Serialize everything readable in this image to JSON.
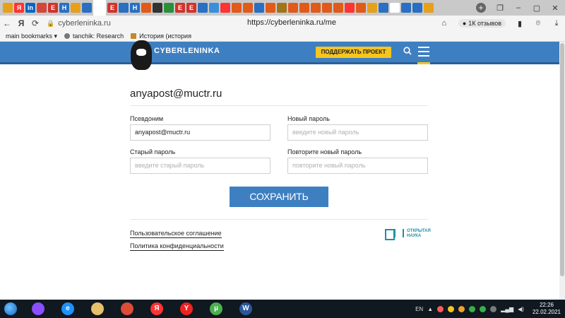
{
  "browser": {
    "tab_favicons": [
      {
        "icon": "mail-icon",
        "color": "#e6a01a",
        "text": ""
      },
      {
        "icon": "yandex-icon",
        "color": "#ff3333",
        "text": "Я"
      },
      {
        "icon": "linkedin-icon",
        "color": "#0a66c2",
        "text": "in"
      },
      {
        "icon": "gmail-icon",
        "color": "#d44638",
        "text": ""
      },
      {
        "icon": "e-icon",
        "color": "#d0342c",
        "text": "E"
      },
      {
        "icon": "h-icon",
        "color": "#2a6fc1",
        "text": "H"
      },
      {
        "icon": "mail-icon",
        "color": "#e6a01a",
        "text": ""
      },
      {
        "icon": "doc-icon",
        "color": "#2a6fc1",
        "text": ""
      },
      {
        "icon": "cyberleninka-icon",
        "color": "#ffffff",
        "text": ""
      },
      {
        "icon": "e-icon",
        "color": "#d0342c",
        "text": "E"
      },
      {
        "icon": "doc-icon",
        "color": "#2a6fc1",
        "text": ""
      },
      {
        "icon": "h-icon",
        "color": "#2a6fc1",
        "text": "H"
      },
      {
        "icon": "grid-icon",
        "color": "#e05a1a",
        "text": ""
      },
      {
        "icon": "circle-icon",
        "color": "#333333",
        "text": ""
      },
      {
        "icon": "arrow-icon",
        "color": "#2a8f3a",
        "text": ""
      },
      {
        "icon": "e-icon",
        "color": "#d0342c",
        "text": "E"
      },
      {
        "icon": "e-icon",
        "color": "#d0342c",
        "text": "E"
      },
      {
        "icon": "planet-icon",
        "color": "#2a6fc1",
        "text": ""
      },
      {
        "icon": "bird-icon",
        "color": "#3a8fd9",
        "text": ""
      },
      {
        "icon": "yandex-icon",
        "color": "#ff3333",
        "text": ""
      },
      {
        "icon": "grid-icon",
        "color": "#e05a1a",
        "text": ""
      },
      {
        "icon": "grid-icon",
        "color": "#e05a1a",
        "text": ""
      },
      {
        "icon": "flag-icon",
        "color": "#2a6fc1",
        "text": ""
      },
      {
        "icon": "grid-icon",
        "color": "#e05a1a",
        "text": ""
      },
      {
        "icon": "seal-icon",
        "color": "#a0741a",
        "text": ""
      },
      {
        "icon": "grid-icon",
        "color": "#e05a1a",
        "text": ""
      },
      {
        "icon": "grid-icon",
        "color": "#e05a1a",
        "text": ""
      },
      {
        "icon": "grid-icon",
        "color": "#e05a1a",
        "text": ""
      },
      {
        "icon": "grid-icon",
        "color": "#e05a1a",
        "text": ""
      },
      {
        "icon": "grid-icon",
        "color": "#e05a1a",
        "text": ""
      },
      {
        "icon": "yandex-icon",
        "color": "#ff3333",
        "text": ""
      },
      {
        "icon": "grid-icon",
        "color": "#e05a1a",
        "text": ""
      },
      {
        "icon": "mail-icon",
        "color": "#e6a01a",
        "text": ""
      },
      {
        "icon": "flag-icon",
        "color": "#2a6fc1",
        "text": ""
      },
      {
        "icon": "flag-icon",
        "color": "#ffffff",
        "text": ""
      },
      {
        "icon": "h-icon",
        "color": "#2a6fc1",
        "text": ""
      },
      {
        "icon": "doc-icon",
        "color": "#2a6fc1",
        "text": ""
      },
      {
        "icon": "mail-icon",
        "color": "#e6a01a",
        "text": ""
      }
    ],
    "new_tab_label": "+",
    "address": {
      "host": "cyberleninka.ru",
      "url": "https://cyberleninka.ru/me",
      "reviews_label": "1К отзывов"
    },
    "bookmarks": [
      {
        "label": "main bookmarks ▾",
        "icon": ""
      },
      {
        "label": "tanchik: Research",
        "icon": "user-icon"
      },
      {
        "label": "История (история",
        "icon": "history-icon"
      }
    ]
  },
  "site": {
    "logo_text": "CYBERLENINKA",
    "support_label": "ПОДДЕРЖАТЬ ПРОЕКТ",
    "colors": {
      "header": "#3e7fc1",
      "accent": "#f7c51e"
    }
  },
  "profile": {
    "email": "anyapost@muctr.ru",
    "fields": {
      "nickname_label": "Псевдоним",
      "nickname_value": "anyapost@muctr.ru",
      "new_password_label": "Новый пароль",
      "new_password_placeholder": "введите новый пароль",
      "old_password_label": "Старый пароль",
      "old_password_placeholder": "введите старый пароль",
      "repeat_password_label": "Повторите новый пароль",
      "repeat_password_placeholder": "повторите новый пароль"
    },
    "save_label": "СОХРАНИТЬ",
    "links": {
      "terms": "Пользовательское соглашение",
      "privacy": "Политика конфиденциальности"
    },
    "open_science_lines": [
      "ОТКРЫТАЯ",
      "НАУКА"
    ]
  },
  "taskbar": {
    "apps": [
      {
        "name": "alice-icon",
        "color": "#8a4fff",
        "text": ""
      },
      {
        "name": "ie-icon",
        "color": "#1e90ff",
        "text": "e"
      },
      {
        "name": "explorer-icon",
        "color": "#e6c06a",
        "text": ""
      },
      {
        "name": "chrome-icon",
        "color": "#dd4b39",
        "text": ""
      },
      {
        "name": "yandex-browser-icon",
        "color": "#ff3333",
        "text": "Я"
      },
      {
        "name": "yandex-icon",
        "color": "#e22",
        "text": "Y"
      },
      {
        "name": "utorrent-icon",
        "color": "#4caf50",
        "text": "µ"
      },
      {
        "name": "word-icon",
        "color": "#2b579a",
        "text": "W"
      }
    ],
    "language": "EN",
    "time": "22:26",
    "date": "22.02.2021"
  }
}
